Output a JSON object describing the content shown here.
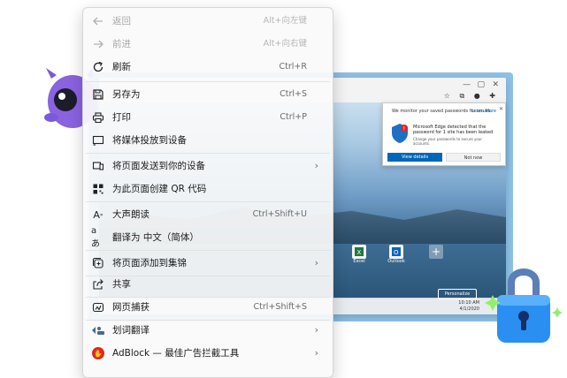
{
  "menu": {
    "items": [
      {
        "icon": "arrow-left-icon",
        "label": "返回",
        "shortcut": "Alt+向左键",
        "disabled": true
      },
      {
        "icon": "arrow-right-icon",
        "label": "前进",
        "shortcut": "Alt+向右键",
        "disabled": true
      },
      {
        "icon": "refresh-icon",
        "label": "刷新",
        "shortcut": "Ctrl+R"
      },
      {
        "icon": "save-as-icon",
        "label": "另存为",
        "shortcut": "Ctrl+S"
      },
      {
        "icon": "print-icon",
        "label": "打印",
        "shortcut": "Ctrl+P"
      },
      {
        "icon": "cast-icon",
        "label": "将媒体投放到设备"
      },
      {
        "icon": "send-to-device-icon",
        "label": "将页面发送到你的设备",
        "submenu": true
      },
      {
        "icon": "qr-code-icon",
        "label": "为此页面创建 QR 代码"
      },
      {
        "icon": "read-aloud-icon",
        "label": "大声朗读",
        "shortcut": "Ctrl+Shift+U"
      },
      {
        "icon": "translate-icon",
        "label": "翻译为 中文（简体）"
      },
      {
        "icon": "collections-icon",
        "label": "将页面添加到集锦",
        "submenu": true
      },
      {
        "icon": "share-icon",
        "label": "共享"
      },
      {
        "icon": "web-capture-icon",
        "label": "网页捕获",
        "shortcut": "Ctrl+Shift+S"
      },
      {
        "icon": "word-translate-icon",
        "label": "划词翻译",
        "submenu": true
      },
      {
        "icon": "adblock-icon",
        "label": "AdBlock — 最佳广告拦截工具",
        "submenu": true
      }
    ]
  },
  "browser_window": {
    "alert": {
      "title": "We monitor your saved passwords for issues.",
      "learn_more": "Learn More",
      "message": "Microsoft Edge detected that the password for 1 site has been leaked",
      "sub": "Change your passwords to secure your accounts.",
      "primary_button": "View details",
      "secondary_button": "Not now"
    },
    "tiles": [
      "Excel",
      "Outlook"
    ],
    "personalize": "Personalize",
    "clock": "10:10 AM",
    "date": "4/1/2020"
  }
}
